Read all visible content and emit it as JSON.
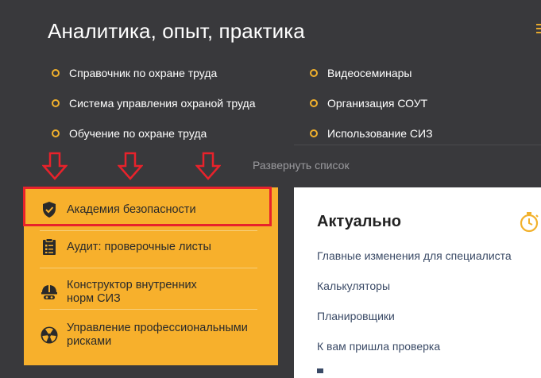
{
  "header": {
    "title": "Аналитика, опыт, практика",
    "expand_label": "Развернуть список"
  },
  "links": {
    "left": [
      "Справочник по охране труда",
      "Система управления охраной труда",
      "Обучение по охране труда"
    ],
    "right": [
      "Видеосеминары",
      "Организация СОУТ",
      "Использование СИЗ"
    ]
  },
  "panel": {
    "items": [
      {
        "label": "Академия безопасности",
        "icon": "shield-check-icon"
      },
      {
        "label": "Аудит: проверочные листы",
        "icon": "clipboard-checklist-icon"
      },
      {
        "label": "Конструктор внутренних норм СИЗ",
        "icon": "hardhat-goggles-icon"
      },
      {
        "label": "Управление профессиональными рисками",
        "icon": "radiation-icon"
      }
    ]
  },
  "card": {
    "title": "Актуально",
    "icon": "stopwatch-icon",
    "links": [
      "Главные изменения для специалиста",
      "Калькуляторы",
      "Планировщики",
      "К вам пришла проверка"
    ]
  },
  "colors": {
    "accent": "#f7b02c",
    "background": "#39393c",
    "annotation_red": "#e8222b"
  }
}
